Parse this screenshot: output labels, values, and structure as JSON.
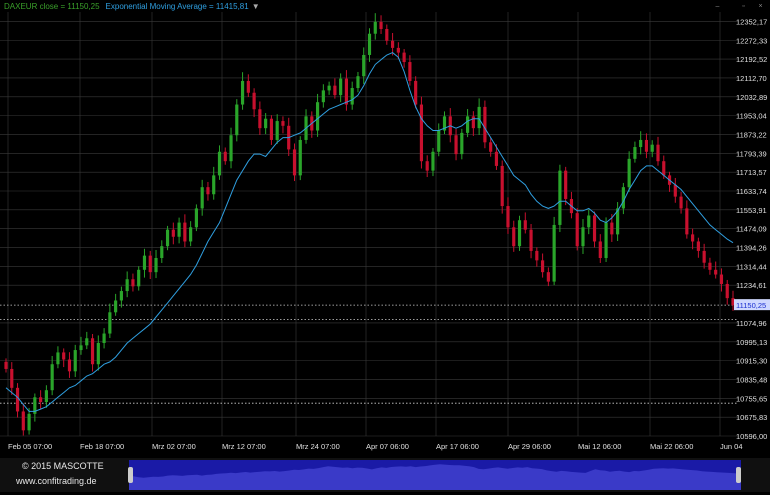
{
  "legend": {
    "close_label": "DAXEUR close = 11150,25",
    "ema_label": "Exponential Moving Average = 11415,81",
    "dropdown_icon": "triangle-down-icon"
  },
  "footer": {
    "copyright": "© 2015 MASCOTTE",
    "url": "www.confitrading.de"
  },
  "colors": {
    "up": "#2aa52a",
    "down": "#c8102e",
    "ema": "#2f9fe0",
    "grid": "#3a3a3a",
    "price_tag_bg": "#cfd8ff",
    "navigator": "#1a1aa6",
    "navigator_area": "#3a3ac8"
  },
  "chart_data": {
    "type": "candlestick",
    "y_ticks": [
      "12352,17",
      "12272,33",
      "12192,52",
      "12112,70",
      "12032,89",
      "11953,04",
      "11873,22",
      "11793,39",
      "11713,57",
      "11633,74",
      "11553,91",
      "11474,09",
      "11394,26",
      "11314,44",
      "11234,61",
      "11150,25",
      "11074,96",
      "10995,13",
      "10915,30",
      "10835,48",
      "10755,65",
      "10675,83",
      "10596,00"
    ],
    "ylim": [
      10596,
      12392
    ],
    "x_ticks": [
      "Feb 05 07:00",
      "Feb 18 07:00",
      "Mrz 02 07:00",
      "Mrz 12 07:00",
      "Mrz 24 07:00",
      "Apr 07 06:00",
      "Apr 17 06:00",
      "Apr 29 06:00",
      "Mai 12 06:00",
      "Mai 22 06:00",
      "Jun 04"
    ],
    "last_price": 11150.25,
    "dotted_levels": [
      11150.25,
      11090,
      10735
    ],
    "close": [
      10880,
      10800,
      10700,
      10620,
      10690,
      10760,
      10740,
      10790,
      10900,
      10950,
      10920,
      10870,
      10960,
      10980,
      11010,
      10900,
      10990,
      11030,
      11120,
      11170,
      11210,
      11260,
      11230,
      11300,
      11360,
      11290,
      11350,
      11400,
      11470,
      11440,
      11500,
      11420,
      11480,
      11560,
      11650,
      11620,
      11700,
      11800,
      11760,
      11870,
      12000,
      12100,
      12050,
      11980,
      11900,
      11940,
      11850,
      11930,
      11910,
      11810,
      11700,
      11850,
      11950,
      11890,
      12010,
      12060,
      12080,
      12040,
      12110,
      12000,
      12070,
      12120,
      12210,
      12300,
      12350,
      12320,
      12270,
      12240,
      12220,
      12180,
      12100,
      12000,
      11760,
      11720,
      11800,
      11890,
      11950,
      11870,
      11790,
      11880,
      11950,
      11900,
      11990,
      11840,
      11800,
      11740,
      11570,
      11480,
      11400,
      11510,
      11470,
      11380,
      11340,
      11290,
      11250,
      11490,
      11720,
      11600,
      11540,
      11400,
      11480,
      11530,
      11420,
      11350,
      11500,
      11450,
      11560,
      11650,
      11770,
      11820,
      11850,
      11800,
      11830,
      11760,
      11700,
      11660,
      11610,
      11560,
      11450,
      11420,
      11380,
      11330,
      11300,
      11280,
      11240,
      11180,
      11150
    ],
    "ema": [
      10800,
      10780,
      10760,
      10730,
      10700,
      10700,
      10710,
      10720,
      10740,
      10760,
      10780,
      10800,
      10810,
      10830,
      10850,
      10860,
      10880,
      10900,
      10910,
      10930,
      10960,
      10990,
      11010,
      11030,
      11050,
      11070,
      11100,
      11130,
      11160,
      11190,
      11220,
      11250,
      11280,
      11320,
      11370,
      11420,
      11460,
      11500,
      11560,
      11620,
      11680,
      11720,
      11760,
      11790,
      11790,
      11780,
      11810,
      11840,
      11860,
      11860,
      11870,
      11880,
      11900,
      11920,
      11940,
      11960,
      11980,
      11990,
      12000,
      12010,
      12020,
      12040,
      12080,
      12130,
      12170,
      12190,
      12210,
      12220,
      12200,
      12140,
      12060,
      11990,
      11940,
      11910,
      11890,
      11890,
      11900,
      11910,
      11900,
      11910,
      11930,
      11940,
      11940,
      11900,
      11860,
      11820,
      11780,
      11740,
      11700,
      11680,
      11660,
      11620,
      11590,
      11570,
      11560,
      11570,
      11590,
      11590,
      11570,
      11550,
      11550,
      11560,
      11540,
      11510,
      11500,
      11520,
      11550,
      11590,
      11640,
      11680,
      11720,
      11740,
      11740,
      11720,
      11700,
      11680,
      11660,
      11640,
      11610,
      11580,
      11550,
      11520,
      11490,
      11470,
      11450,
      11430,
      11415
    ]
  }
}
